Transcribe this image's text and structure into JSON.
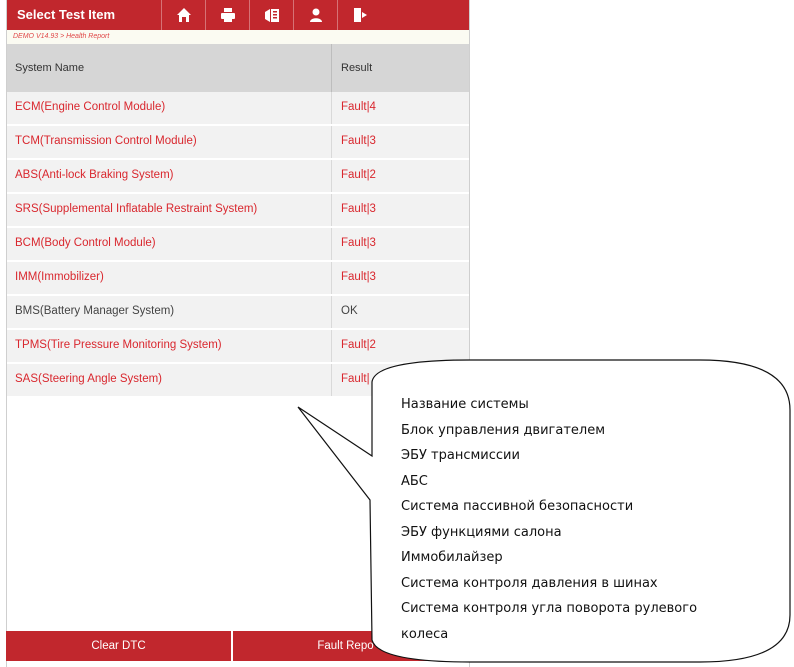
{
  "header": {
    "title": "Select Test Item",
    "icons": [
      "home-icon",
      "print-icon",
      "report-icon",
      "user-icon",
      "exit-icon"
    ]
  },
  "breadcrumb": "DEMO V14.93 > Health Report",
  "table": {
    "col_system": "System Name",
    "col_result": "Result",
    "rows": [
      {
        "name": "ECM(Engine Control Module)",
        "result": "Fault|4",
        "status": "fault"
      },
      {
        "name": "TCM(Transmission Control Module)",
        "result": "Fault|3",
        "status": "fault"
      },
      {
        "name": "ABS(Anti-lock Braking System)",
        "result": "Fault|2",
        "status": "fault"
      },
      {
        "name": "SRS(Supplemental Inflatable Restraint System)",
        "result": "Fault|3",
        "status": "fault"
      },
      {
        "name": "BCM(Body Control Module)",
        "result": "Fault|3",
        "status": "fault"
      },
      {
        "name": "IMM(Immobilizer)",
        "result": "Fault|3",
        "status": "fault"
      },
      {
        "name": "BMS(Battery Manager System)",
        "result": "OK",
        "status": "ok"
      },
      {
        "name": "TPMS(Tire Pressure Monitoring System)",
        "result": "Fault|2",
        "status": "fault"
      },
      {
        "name": "SAS(Steering Angle System)",
        "result": "Fault|",
        "status": "fault"
      }
    ]
  },
  "footer": {
    "clear_dtc": "Clear DTC",
    "fault_report": "Fault Repo"
  },
  "callout": {
    "lines": [
      "Название системы",
      "Блок управления двигателем",
      "ЭБУ трансмиссии",
      "АБС",
      "Система пассивной безопасности",
      "ЭБУ функциями салона",
      "Иммобилайзер",
      "Система контроля давления в шинах",
      "Система контроля угла поворота рулевого",
      "колеса"
    ]
  },
  "colors": {
    "accent": "#c1272d",
    "fault": "#d9272e"
  }
}
